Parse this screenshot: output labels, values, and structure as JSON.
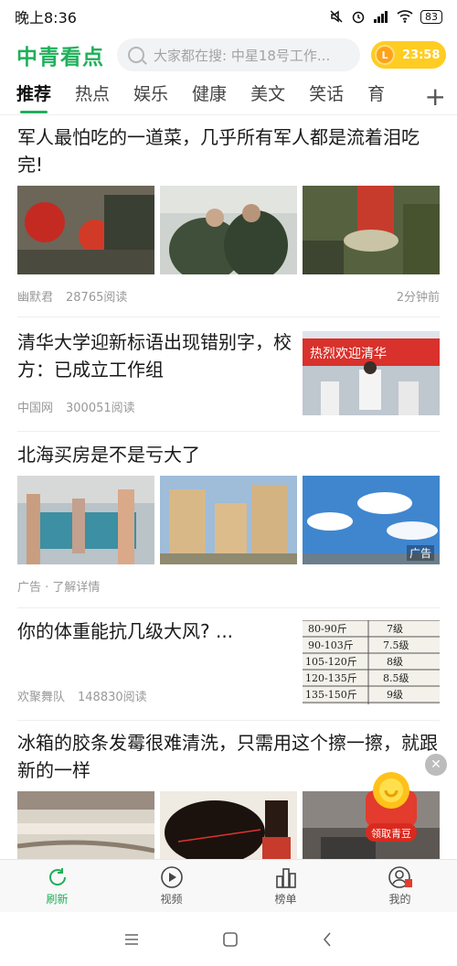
{
  "status": {
    "time": "晚上8:36",
    "battery": "83"
  },
  "header": {
    "logo": "中青看点",
    "search_placeholder": "大家都在搜: 中星18号工作...",
    "timer_coin": "L",
    "timer": "23:58"
  },
  "tabs": [
    "推荐",
    "热点",
    "娱乐",
    "健康",
    "美文",
    "笑话",
    "育"
  ],
  "feed": {
    "a1": {
      "title": "军人最怕吃的一道菜，几乎所有军人都是流着泪吃完!",
      "source": "幽默君",
      "reads": "28765阅读",
      "time": "2分钟前"
    },
    "a2": {
      "title": "清华大学迎新标语出现错别字，校方：已成立工作组",
      "source": "中国网",
      "reads": "300051阅读"
    },
    "a3": {
      "title": "北海买房是不是亏大了",
      "ad_badge": "广告",
      "meta": "广告 · 了解详情"
    },
    "a4": {
      "title": "你的体重能抗几级大风? ...",
      "source": "欢聚舞队",
      "reads": "148830阅读",
      "table": [
        [
          "80-90斤",
          "7级"
        ],
        [
          "90-103斤",
          "7.5级"
        ],
        [
          "105-120斤",
          "8级"
        ],
        [
          "120-135斤",
          "8.5级"
        ],
        [
          "135-150斤",
          "9级"
        ]
      ]
    },
    "a5": {
      "title": "冰箱的胶条发霉很难清洗，只需用这个擦一擦，就跟新的一样"
    },
    "a2_banner": "热烈欢迎清华"
  },
  "float": {
    "label": "领取青豆",
    "close": "✕"
  },
  "bottom_nav": [
    {
      "label": "刷新"
    },
    {
      "label": "视频"
    },
    {
      "label": "榜单"
    },
    {
      "label": "我的"
    }
  ],
  "colors": {
    "accent": "#1fb05a",
    "timer": "#ffcc22"
  }
}
